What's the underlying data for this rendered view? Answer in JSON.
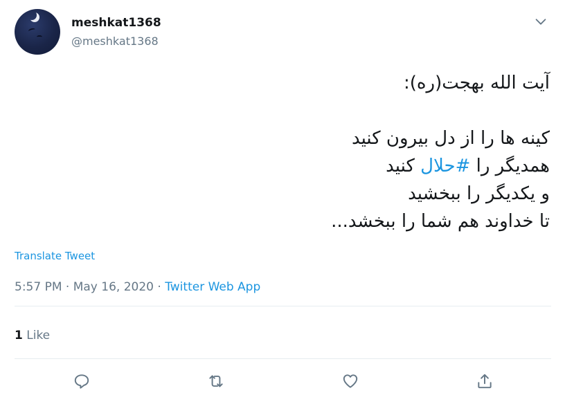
{
  "user": {
    "display_name": "meshkat1368",
    "handle": "@meshkat1368"
  },
  "tweet": {
    "line1": "آیت الله بهجت(ره):",
    "line2": "کینه ها را از دل بیرون کنید",
    "line3_prefix": "همدیگر را ",
    "hashtag": "#حلال",
    "line3_suffix": " کنید",
    "line4": "و یکدیگر را ببخشید",
    "line5": "تا خداوند هم شما را ببخشد..."
  },
  "translate_label": "Translate Tweet",
  "meta": {
    "time": "5:57 PM",
    "separator1": " · ",
    "date": "May 16, 2020",
    "separator2": " · ",
    "source": "Twitter Web App"
  },
  "stats": {
    "like_count": "1",
    "like_label": "Like"
  },
  "icons": {
    "reply": "reply-icon",
    "retweet": "retweet-icon",
    "like": "heart-icon",
    "share": "share-icon",
    "caret": "chevron-down-icon"
  },
  "colors": {
    "accent": "#1b95e0",
    "muted": "#657786",
    "text": "#14171a",
    "divider": "#e6ecf0"
  }
}
